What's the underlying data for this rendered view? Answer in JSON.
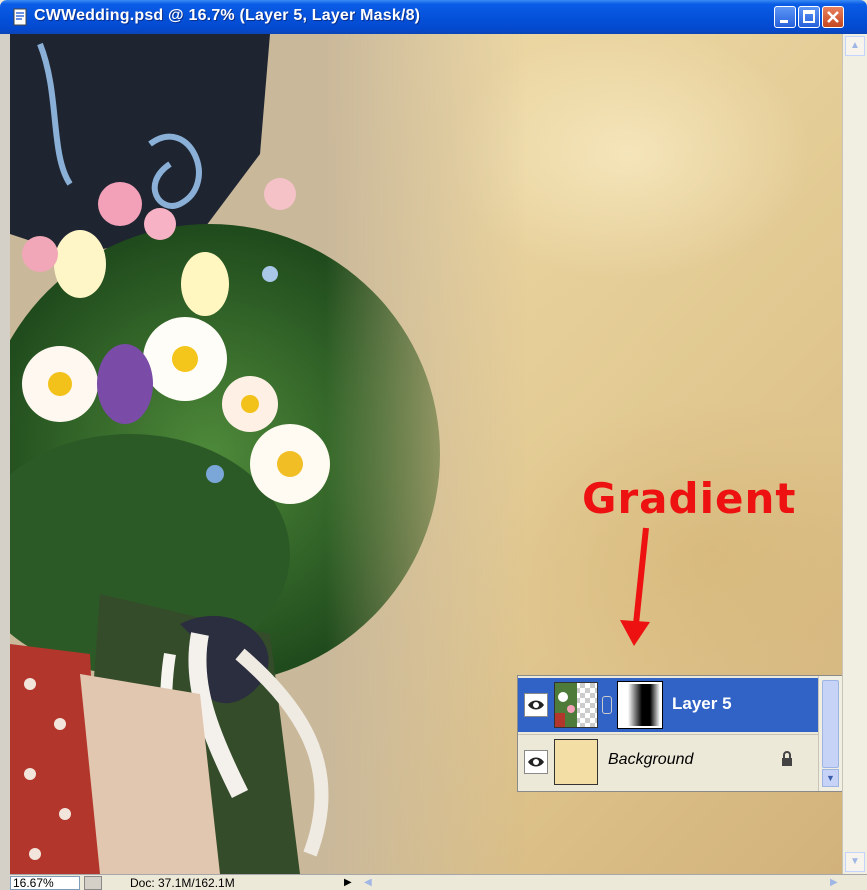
{
  "window": {
    "title": "CWWedding.psd @ 16.7% (Layer 5, Layer Mask/8)",
    "icon": "photoshop-document-icon",
    "buttons": [
      "minimize-icon",
      "maximize-icon",
      "close-icon"
    ]
  },
  "annotation": {
    "label": "Gradient",
    "color": "#EE1111"
  },
  "layers_panel": {
    "layers": [
      {
        "name": "Layer 5",
        "selected": true,
        "has_mask": true
      },
      {
        "name": "Background",
        "selected": false,
        "locked": true
      }
    ]
  },
  "statusbar": {
    "zoom": "16.67%",
    "doc_info": "Doc: 37.1M/162.1M"
  },
  "colors": {
    "title_bar": "#0552DB",
    "selection": "#3163C6",
    "parchment": "#E9D39E"
  }
}
